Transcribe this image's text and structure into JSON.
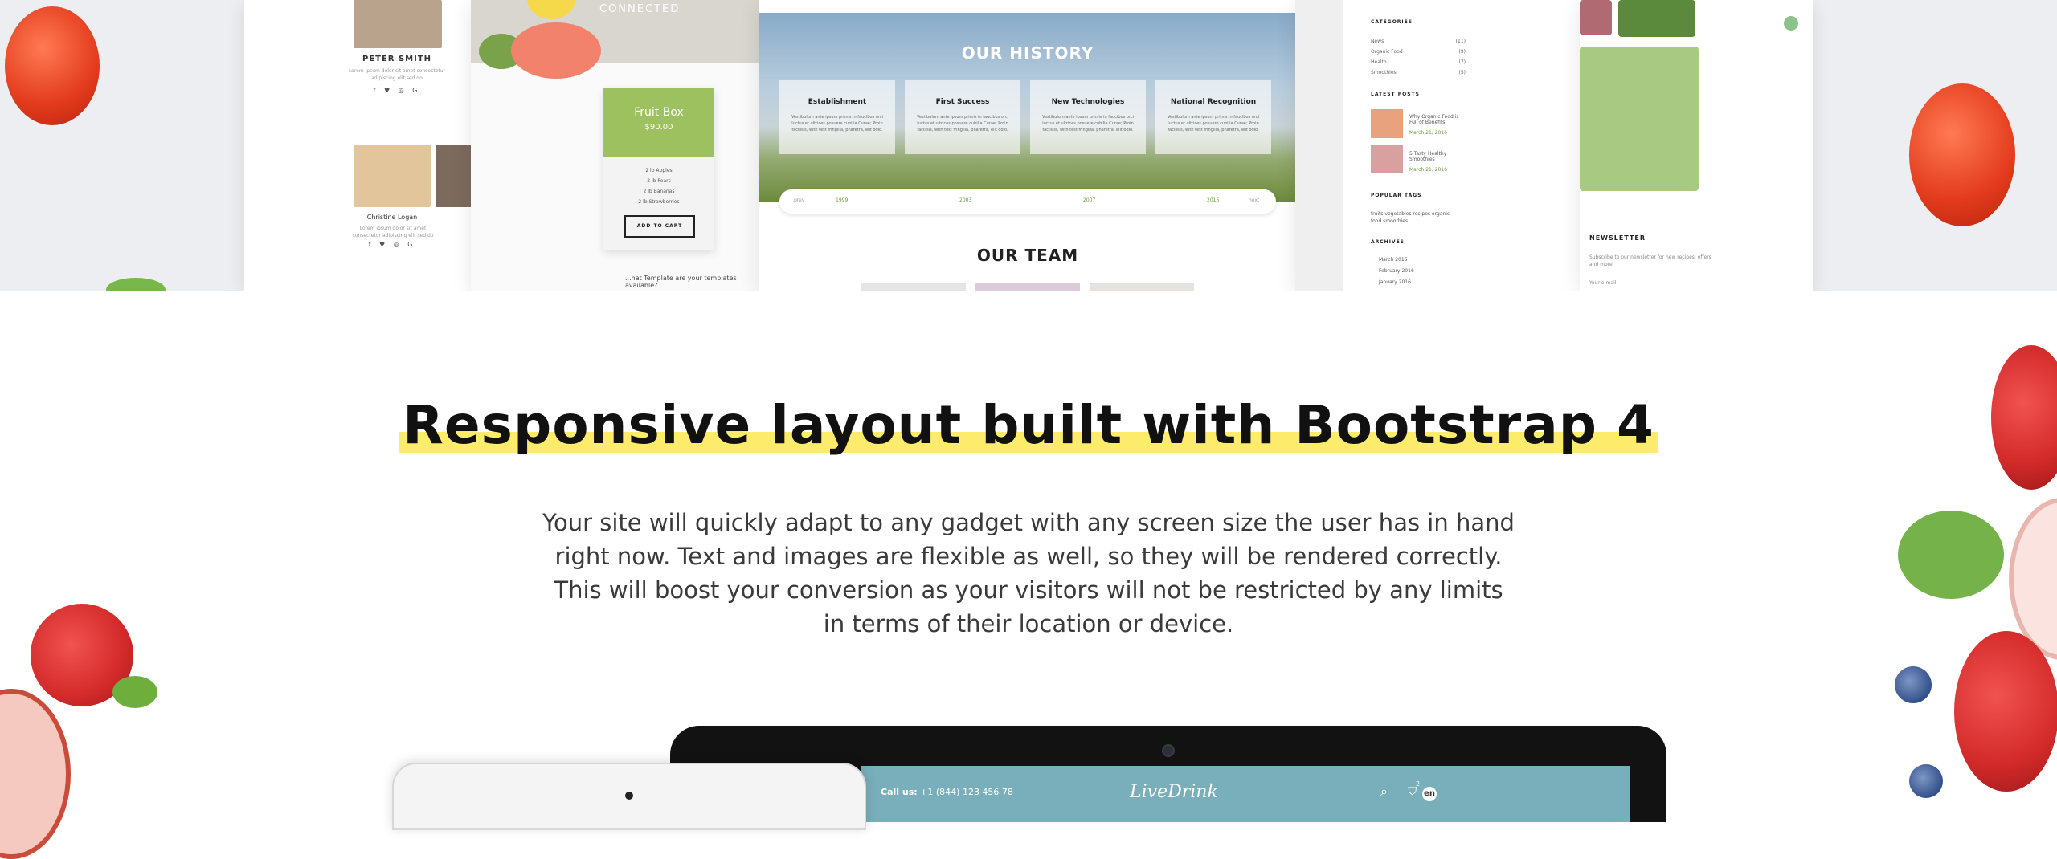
{
  "team_shot": {
    "member1_name": "PETER SMITH",
    "member1_desc": "Lorem ipsum dolor sit amet consectetur adipiscing elit sed do",
    "member2_name": "Christine Logan",
    "member2_desc": "Lorem ipsum dolor sit amet consectetur adipiscing elit sed do",
    "social": "f ♥ ◎ G"
  },
  "fruit_shot": {
    "header_label": "CONNECTED",
    "card_title": "Fruit Box",
    "card_price": "$90.00",
    "card_features": [
      "2 lb Apples",
      "2 lb Pears",
      "2 lb Bananas",
      "2 lb Strawberries"
    ],
    "card_button": "ADD TO CART",
    "footer_text": "...hat Template are your templates available?"
  },
  "history_shot": {
    "title": "OUR HISTORY",
    "milestones": [
      {
        "title": "Establishment",
        "desc": "Vestibulum ante ipsum primis in faucibus orci luctus et ultrices posuere cubilia Curae; Proin facilisis, with test fringilla, pharetra, elit odio."
      },
      {
        "title": "First Success",
        "desc": "Vestibulum ante ipsum primis in faucibus orci luctus et ultrices posuere cubilia Curae; Proin facilisis, with test fringilla, pharetra, elit odio."
      },
      {
        "title": "New Technologies",
        "desc": "Vestibulum ante ipsum primis in faucibus orci luctus et ultrices posuere cubilia Curae; Proin facilisis, with test fringilla, pharetra, elit odio."
      },
      {
        "title": "National Recognition",
        "desc": "Vestibulum ante ipsum primis in faucibus orci luctus et ultrices posuere cubilia Curae; Proin facilisis, with test fringilla, pharetra, elit odio."
      }
    ],
    "timeline_years": [
      "1999",
      "2003",
      "2007",
      "2015"
    ],
    "timeline_prev": "prev",
    "timeline_next": "next",
    "team_title": "OUR TEAM"
  },
  "blog_shot": {
    "categories_heading": "CATEGORIES",
    "categories": [
      {
        "label": "News",
        "count": "(11)"
      },
      {
        "label": "Organic Food",
        "count": "(9)"
      },
      {
        "label": "Health",
        "count": "(7)"
      },
      {
        "label": "Smoothies",
        "count": "(5)"
      }
    ],
    "latest_heading": "LATEST POSTS",
    "posts": [
      {
        "title": "Why Organic Food is Full of Benefits",
        "date": "March 21, 2016"
      },
      {
        "title": "5 Tasty Healthy Smoothies",
        "date": "March 21, 2016"
      }
    ],
    "tags_heading": "POPULAR TAGS",
    "tags": "fruits  vegetables  recipes  organic  food  smoothies",
    "archives_heading": "ARCHIVES",
    "archives": [
      "March 2016",
      "February 2016",
      "January 2016"
    ]
  },
  "salad_shot": {
    "newsletter_heading": "NEWSLETTER",
    "newsletter_desc": "Subscribe to our newsletter for new recipes, offers and more.",
    "email_placeholder": "Your e-mail"
  },
  "headline": "Responsive layout built with Bootstrap 4",
  "body_lines": [
    "Your site will quickly adapt to any gadget with any screen size the user has in hand",
    "right now. Text and images are flexible as well, so they will be rendered correctly.",
    "This will boost your conversion as your visitors will not be restricted by any limits",
    "in terms of their location or device."
  ],
  "device_screen": {
    "contact_label": "Call us:",
    "contact_phone": "+1 (844) 123 456 78",
    "logo": "LiveDrink",
    "icons": "⌕ ⛉",
    "cart_count": "2",
    "lang": "en"
  },
  "colors": {
    "highlight": "#fdec6b",
    "accent_green": "#6a9a3a",
    "screen_header": "#79afba"
  }
}
